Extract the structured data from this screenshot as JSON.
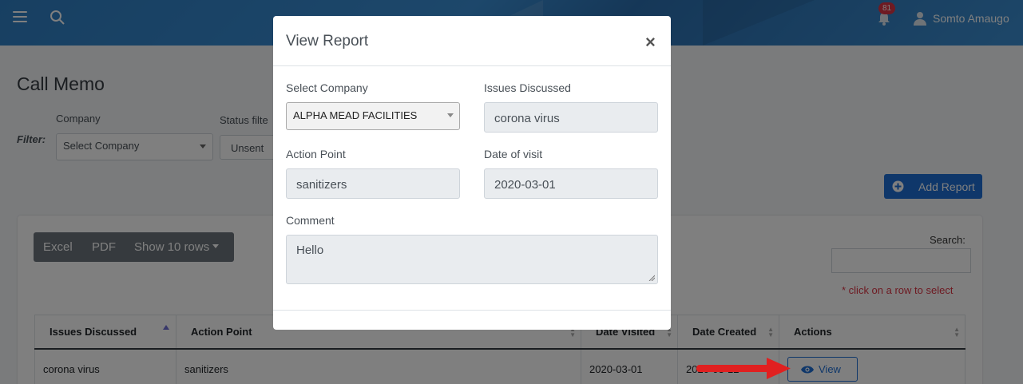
{
  "header": {
    "notification_count": "81",
    "user_name": "Somto Amaugo"
  },
  "page": {
    "title": "Call Memo",
    "filter_label": "Filter:",
    "company_label": "Company",
    "company_select_value": "Select Company",
    "status_label": "Status filte",
    "status_select_value": "Unsent",
    "add_report_label": "Add Report"
  },
  "table_tools": {
    "excel_label": "Excel",
    "pdf_label": "PDF",
    "rows_label": "Show 10 rows",
    "search_label": "Search:",
    "hint": "* click on a row to select"
  },
  "table": {
    "headers": [
      "Issues Discussed",
      "Action Point",
      "Date Visited",
      "Date Created",
      "Actions"
    ],
    "rows": [
      {
        "issues": "corona virus",
        "action": "sanitizers",
        "date_visited": "2020-03-01",
        "date_created": "2020-03-12",
        "action_label": "View"
      }
    ]
  },
  "modal": {
    "title": "View Report",
    "close_symbol": "×",
    "company_label": "Select Company",
    "company_value": "ALPHA MEAD FACILITIES",
    "issues_label": "Issues Discussed",
    "issues_value": "corona virus",
    "action_label": "Action Point",
    "action_value": "sanitizers",
    "date_label": "Date of visit",
    "date_value": "2020-03-01",
    "comment_label": "Comment",
    "comment_value": "Hello"
  },
  "colors": {
    "primary": "#1f6fd4",
    "danger": "#dc3545",
    "annotation_arrow": "#e02020"
  }
}
